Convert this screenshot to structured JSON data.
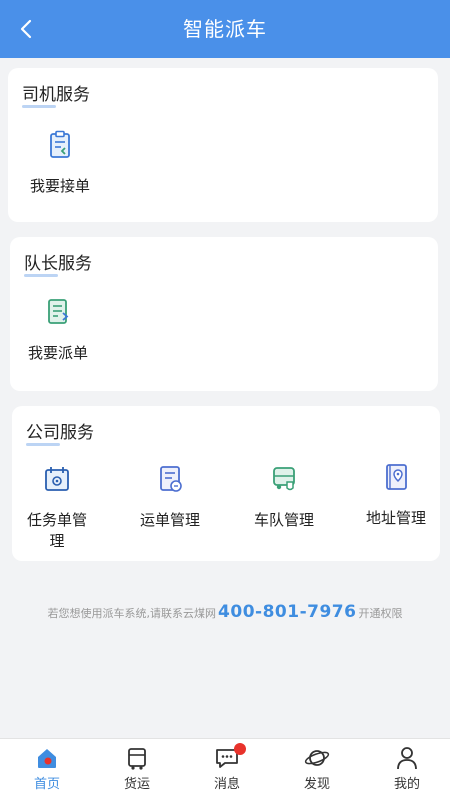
{
  "header": {
    "title": "智能派车"
  },
  "driver": {
    "title": "司机服务",
    "items": [
      {
        "label": "我要接单",
        "icon": "accept-order-icon"
      }
    ]
  },
  "captain": {
    "title": "队长服务",
    "items": [
      {
        "label": "我要派单",
        "icon": "dispatch-order-icon"
      }
    ]
  },
  "company": {
    "title": "公司服务",
    "items": [
      {
        "label": "任务单管理",
        "icon": "task-calendar-icon"
      },
      {
        "label": "运单管理",
        "icon": "waybill-icon"
      },
      {
        "label": "车队管理",
        "icon": "fleet-truck-icon"
      },
      {
        "label": "地址管理",
        "icon": "address-location-icon"
      }
    ]
  },
  "hint": {
    "prefix": "若您想使用派车系统,请联系云煤网",
    "phone": "400-801-7976",
    "suffix": "开通权限"
  },
  "tabbar": {
    "items": [
      {
        "label": "首页",
        "icon": "home-icon",
        "active": true
      },
      {
        "label": "货运",
        "icon": "freight-icon"
      },
      {
        "label": "消息",
        "icon": "message-icon",
        "badge": true
      },
      {
        "label": "发现",
        "icon": "discover-planet-icon"
      },
      {
        "label": "我的",
        "icon": "profile-icon"
      }
    ]
  },
  "colors": {
    "primary": "#4a90e9",
    "phone": "#3f8de0",
    "badge": "#e8322b",
    "icon_blue": "#3b78d6",
    "icon_green": "#3aa077"
  }
}
